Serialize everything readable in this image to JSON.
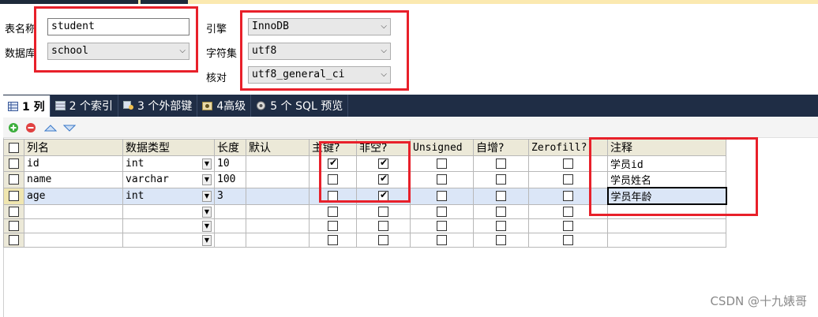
{
  "form": {
    "table_name_label": "表名称",
    "table_name_value": "student",
    "database_label": "数据库",
    "database_value": "school",
    "engine_label": "引擎",
    "engine_value": "InnoDB",
    "charset_label": "字符集",
    "charset_value": "utf8",
    "collation_label": "核对",
    "collation_value": "utf8_general_ci"
  },
  "tabs": [
    {
      "label": "1 列",
      "active": true
    },
    {
      "label": "2 个索引",
      "active": false
    },
    {
      "label": "3 个外部键",
      "active": false
    },
    {
      "label": "4高级",
      "active": false
    },
    {
      "label": "5 个 SQL 预览",
      "active": false
    }
  ],
  "columns_headers": {
    "name": "列名",
    "type": "数据类型",
    "length": "长度",
    "default": "默认",
    "primary": "主键?",
    "notnull": "非空?",
    "unsigned": "Unsigned",
    "autoinc": "自增?",
    "zerofill": "Zerofill?",
    "comment": "注释"
  },
  "rows": [
    {
      "name": "id",
      "type": "int",
      "length": "10",
      "default": "",
      "primary": true,
      "notnull": true,
      "unsigned": false,
      "autoinc": false,
      "zerofill": false,
      "comment": "学员id"
    },
    {
      "name": "name",
      "type": "varchar",
      "length": "100",
      "default": "",
      "primary": false,
      "notnull": true,
      "unsigned": false,
      "autoinc": false,
      "zerofill": false,
      "comment": "学员姓名"
    },
    {
      "name": "age",
      "type": "int",
      "length": "3",
      "default": "",
      "primary": false,
      "notnull": true,
      "unsigned": false,
      "autoinc": false,
      "zerofill": false,
      "comment": "学员年龄"
    },
    {
      "name": "",
      "type": "",
      "length": "",
      "default": "",
      "primary": false,
      "notnull": false,
      "unsigned": false,
      "autoinc": false,
      "zerofill": false,
      "comment": ""
    },
    {
      "name": "",
      "type": "",
      "length": "",
      "default": "",
      "primary": false,
      "notnull": false,
      "unsigned": false,
      "autoinc": false,
      "zerofill": false,
      "comment": ""
    },
    {
      "name": "",
      "type": "",
      "length": "",
      "default": "",
      "primary": false,
      "notnull": false,
      "unsigned": false,
      "autoinc": false,
      "zerofill": false,
      "comment": ""
    }
  ],
  "watermark": "CSDN @十九婊哥",
  "colors": {
    "annotation_red": "#e8202a",
    "tabbar": "#1f2d45"
  }
}
